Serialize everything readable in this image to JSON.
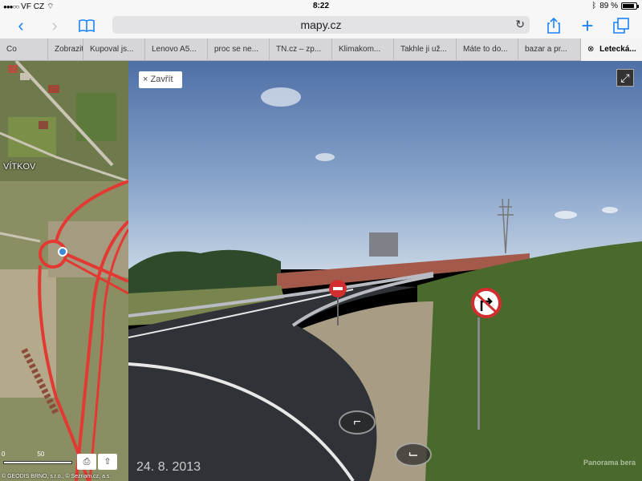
{
  "statusbar": {
    "carrier": "VF CZ",
    "time": "8:22",
    "battery": "89 %"
  },
  "navbar": {
    "back": "‹",
    "forward": "›",
    "bookmarks_icon": "bookmarks-icon",
    "url": "mapy.cz",
    "reload": "↻",
    "share": "⇧",
    "add": "+",
    "tabs_icon": "tabs-icon"
  },
  "tabs": [
    {
      "label": "Co",
      "width": 60
    },
    {
      "label": "Zobrazit",
      "width": 44
    },
    {
      "label": "Kupoval js...",
      "width": 77
    },
    {
      "label": "Lenovo A5...",
      "width": 78
    },
    {
      "label": "proc se ne...",
      "width": 77
    },
    {
      "label": "TN.cz – zp...",
      "width": 78
    },
    {
      "label": "Klimakom...",
      "width": 77
    },
    {
      "label": "Takhle ji už...",
      "width": 78
    },
    {
      "label": "Máte to do...",
      "width": 77
    },
    {
      "label": "bazar a pr...",
      "width": 78
    }
  ],
  "active_tab": {
    "close": "⊗",
    "label": "Letecká..."
  },
  "map": {
    "place_label": "VÍTKOV",
    "scale_zero": "0",
    "scale_value": "50",
    "copyright": "© GEODIS BRNO, s.r.o., © Seznam.cz, a.s.",
    "print": "⎙",
    "share": "⇧"
  },
  "panorama": {
    "close_label": "× Zavřít",
    "fullscreen": "⤢",
    "date": "24. 8. 2013",
    "brand": "Panorama bera",
    "arrow_left": "⌐",
    "arrow_right": "⌙"
  }
}
